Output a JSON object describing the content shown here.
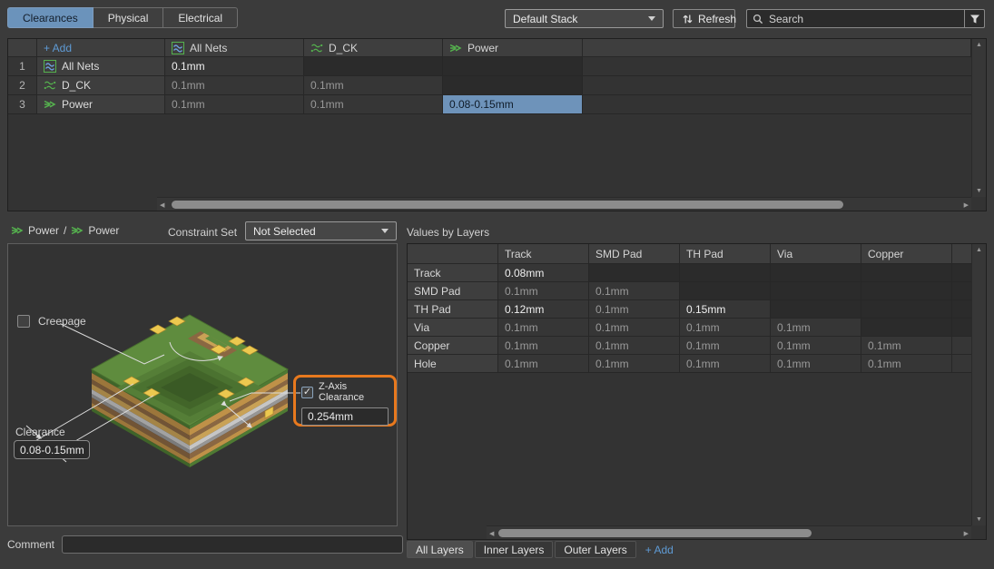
{
  "tabs": [
    {
      "label": "Clearances",
      "active": true
    },
    {
      "label": "Physical",
      "active": false
    },
    {
      "label": "Electrical",
      "active": false
    }
  ],
  "toolbar": {
    "stack_value": "Default Stack",
    "refresh_label": "Refresh",
    "search_placeholder": "Search"
  },
  "matrix": {
    "add_label": "+ Add",
    "columns": [
      {
        "label": "All Nets",
        "icon": "all-nets-icon"
      },
      {
        "label": "D_CK",
        "icon": "diff-pair-icon"
      },
      {
        "label": "Power",
        "icon": "net-class-icon"
      }
    ],
    "rows": [
      {
        "num": "1",
        "label": "All Nets",
        "icon": "all-nets-icon",
        "cells": [
          {
            "text": "0.1mm",
            "state": "set"
          },
          {
            "text": "",
            "state": "empty"
          },
          {
            "text": "",
            "state": "empty"
          }
        ]
      },
      {
        "num": "2",
        "label": "D_CK",
        "icon": "diff-pair-icon",
        "cells": [
          {
            "text": "0.1mm",
            "state": "inherited"
          },
          {
            "text": "0.1mm",
            "state": "inherited"
          },
          {
            "text": "",
            "state": "empty"
          }
        ]
      },
      {
        "num": "3",
        "label": "Power",
        "icon": "net-class-icon",
        "cells": [
          {
            "text": "0.1mm",
            "state": "inherited"
          },
          {
            "text": "0.1mm",
            "state": "inherited"
          },
          {
            "text": "0.08-0.15mm",
            "state": "selected"
          }
        ]
      }
    ]
  },
  "detail": {
    "pair_left": "Power",
    "pair_separator": "/",
    "pair_right": "Power",
    "constraint_set_label": "Constraint Set",
    "constraint_set_value": "Not Selected",
    "creepage_label": "Creepage",
    "zaxis_checkbox_label": "Z-Axis Clearance",
    "zaxis_checked": "✓",
    "zaxis_value": "0.254mm",
    "clearance_label": "Clearance",
    "clearance_value": "0.08-0.15mm",
    "comment_label": "Comment",
    "comment_value": "",
    "highlight_color": "#e8791e"
  },
  "values_by_layers": {
    "title": "Values by Layers",
    "columns": [
      "Track",
      "SMD Pad",
      "TH Pad",
      "Via",
      "Copper"
    ],
    "rows": [
      {
        "label": "Track",
        "cells": [
          {
            "text": "0.08mm",
            "state": "set"
          },
          {
            "text": "",
            "state": "empty"
          },
          {
            "text": "",
            "state": "empty"
          },
          {
            "text": "",
            "state": "empty"
          },
          {
            "text": "",
            "state": "empty"
          }
        ]
      },
      {
        "label": "SMD Pad",
        "cells": [
          {
            "text": "0.1mm",
            "state": "inherited"
          },
          {
            "text": "0.1mm",
            "state": "inherited"
          },
          {
            "text": "",
            "state": "empty"
          },
          {
            "text": "",
            "state": "empty"
          },
          {
            "text": "",
            "state": "empty"
          }
        ]
      },
      {
        "label": "TH Pad",
        "cells": [
          {
            "text": "0.12mm",
            "state": "set"
          },
          {
            "text": "0.1mm",
            "state": "inherited"
          },
          {
            "text": "0.15mm",
            "state": "set"
          },
          {
            "text": "",
            "state": "empty"
          },
          {
            "text": "",
            "state": "empty"
          }
        ]
      },
      {
        "label": "Via",
        "cells": [
          {
            "text": "0.1mm",
            "state": "inherited"
          },
          {
            "text": "0.1mm",
            "state": "inherited"
          },
          {
            "text": "0.1mm",
            "state": "inherited"
          },
          {
            "text": "0.1mm",
            "state": "inherited"
          },
          {
            "text": "",
            "state": "empty"
          }
        ]
      },
      {
        "label": "Copper",
        "cells": [
          {
            "text": "0.1mm",
            "state": "inherited"
          },
          {
            "text": "0.1mm",
            "state": "inherited"
          },
          {
            "text": "0.1mm",
            "state": "inherited"
          },
          {
            "text": "0.1mm",
            "state": "inherited"
          },
          {
            "text": "0.1mm",
            "state": "inherited"
          }
        ]
      },
      {
        "label": "Hole",
        "cells": [
          {
            "text": "0.1mm",
            "state": "inherited"
          },
          {
            "text": "0.1mm",
            "state": "inherited"
          },
          {
            "text": "0.1mm",
            "state": "inherited"
          },
          {
            "text": "0.1mm",
            "state": "inherited"
          },
          {
            "text": "0.1mm",
            "state": "inherited"
          }
        ]
      }
    ],
    "layer_tabs": [
      {
        "label": "All Layers",
        "active": true
      },
      {
        "label": "Inner Layers",
        "active": false
      },
      {
        "label": "Outer Layers",
        "active": false
      }
    ],
    "add_label": "+ Add"
  },
  "colors": {
    "selection_blue": "#6e93ba",
    "link_blue": "#5f9bd5",
    "icon_green": "#55b24e",
    "highlight_orange": "#e8791e"
  }
}
